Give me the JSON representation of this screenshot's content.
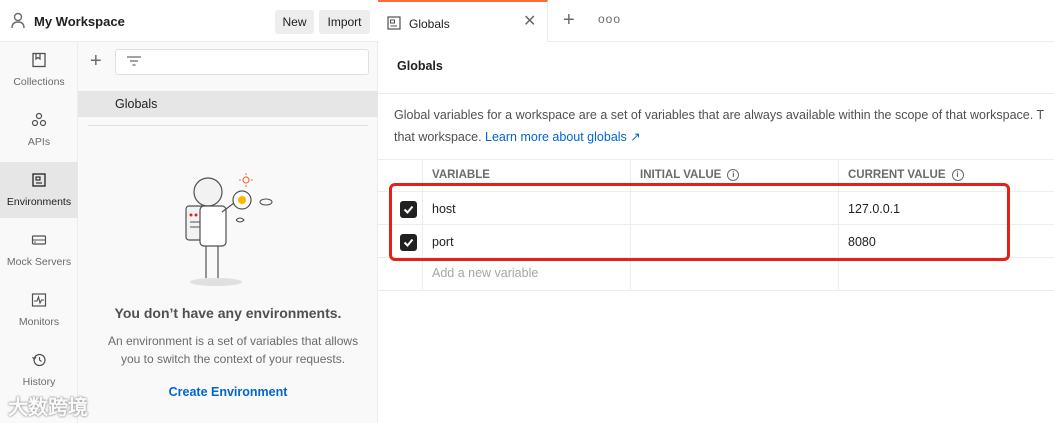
{
  "workspace": {
    "title": "My Workspace",
    "new_label": "New",
    "import_label": "Import"
  },
  "rail": {
    "items": [
      {
        "label": "Collections",
        "icon": "collections-icon"
      },
      {
        "label": "APIs",
        "icon": "apis-icon"
      },
      {
        "label": "Environments",
        "icon": "environments-icon",
        "active": true
      },
      {
        "label": "Mock Servers",
        "icon": "mock-servers-icon"
      },
      {
        "label": "Monitors",
        "icon": "monitors-icon"
      },
      {
        "label": "History",
        "icon": "history-icon"
      }
    ]
  },
  "env_panel": {
    "globals_label": "Globals",
    "empty_title": "You don’t have any environments.",
    "empty_desc_line1": "An environment is a set of variables that allows",
    "empty_desc_line2": "you to switch the context of your requests.",
    "create_label": "Create Environment"
  },
  "tabs": {
    "active_label": "Globals"
  },
  "main": {
    "title": "Globals",
    "desc_line1": "Global variables for a workspace are a set of variables that are always available within the scope of that workspace. T",
    "desc_line2": "that workspace.",
    "learn_more": "Learn more about globals ↗"
  },
  "table": {
    "headers": {
      "variable": "VARIABLE",
      "initial": "INITIAL VALUE",
      "current": "CURRENT VALUE"
    },
    "rows": [
      {
        "variable": "host",
        "initial": "",
        "current": "127.0.0.1",
        "checked": true
      },
      {
        "variable": "port",
        "initial": "",
        "current": "8080",
        "checked": true
      }
    ],
    "add_placeholder": "Add a new variable"
  },
  "watermark": "大数跨境",
  "colors": {
    "accent": "#ff6c37",
    "link": "#0265d2",
    "highlight": "#e32019"
  }
}
